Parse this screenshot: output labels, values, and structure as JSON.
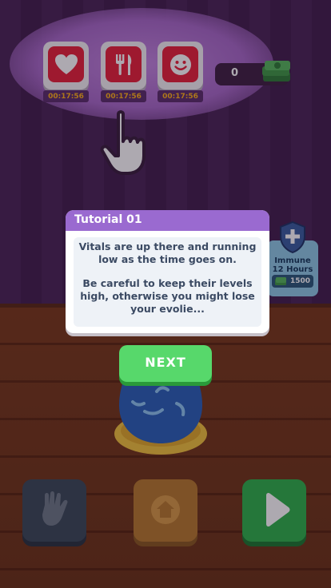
{
  "vitals": [
    {
      "icon": "heart-icon",
      "timer": "00:17:56"
    },
    {
      "icon": "fork-knife-icon",
      "timer": "00:17:56"
    },
    {
      "icon": "smiley-icon",
      "timer": "00:17:56"
    }
  ],
  "currency": {
    "value": "0",
    "icon": "cash-stack-icon"
  },
  "immune": {
    "line1": "Immune",
    "line2": "12 Hours",
    "price": "1500"
  },
  "tutorial": {
    "title": "Tutorial 01",
    "paragraph1": "Vitals are up there and running low as the time goes on.",
    "paragraph2": "Be careful to keep their levels high, otherwise you might lose your evolie..."
  },
  "next_label": "NEXT",
  "bottom_buttons": [
    {
      "icon": "hand-icon"
    },
    {
      "icon": "home-icon"
    },
    {
      "icon": "play-icon"
    }
  ],
  "colors": {
    "vital_red": "#e8233a",
    "dialog_header": "#9a6ad0",
    "next_green": "#57d86b",
    "timer_text": "#ffb21a"
  }
}
